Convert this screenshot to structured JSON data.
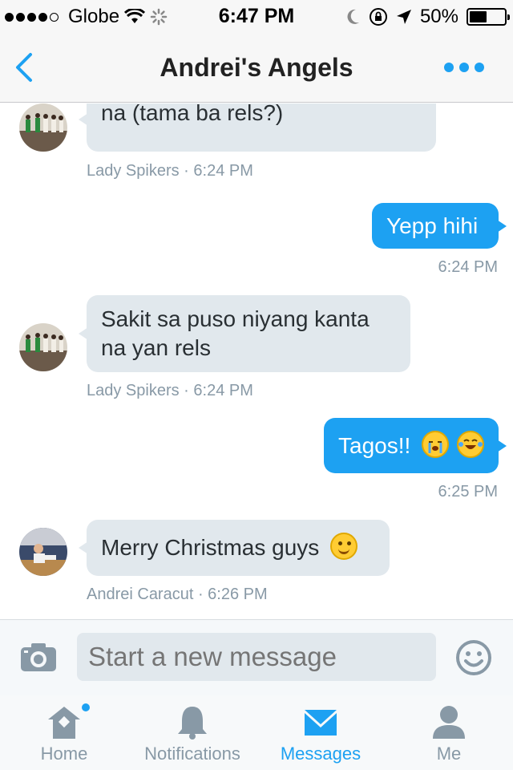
{
  "status_bar": {
    "carrier": "Globe",
    "time": "6:47 PM",
    "battery": "50%",
    "battery_level": 0.5
  },
  "nav": {
    "title": "Andrei's Angels"
  },
  "messages": [
    {
      "partial_text": "na (tama ba rels?)",
      "meta": "Lady Spikers · 6:24 PM"
    },
    {
      "text": "Yepp hihi",
      "meta": "6:24 PM"
    },
    {
      "line1": "Sakit sa puso niyang kanta",
      "line2": "na yan rels",
      "meta": "Lady Spikers · 6:24 PM"
    },
    {
      "text": "Tagos!!",
      "meta": "6:25 PM"
    },
    {
      "text": "Merry Christmas guys",
      "meta": "Andrei Caracut · 6:26 PM"
    }
  ],
  "composer": {
    "placeholder": "Start a new message"
  },
  "tabs": [
    {
      "label": "Home"
    },
    {
      "label": "Notifications"
    },
    {
      "label": "Messages"
    },
    {
      "label": "Me"
    }
  ],
  "colors": {
    "accent": "#1da1f2",
    "incoming_bubble": "#e1e8ed",
    "muted_text": "#8899a6"
  }
}
